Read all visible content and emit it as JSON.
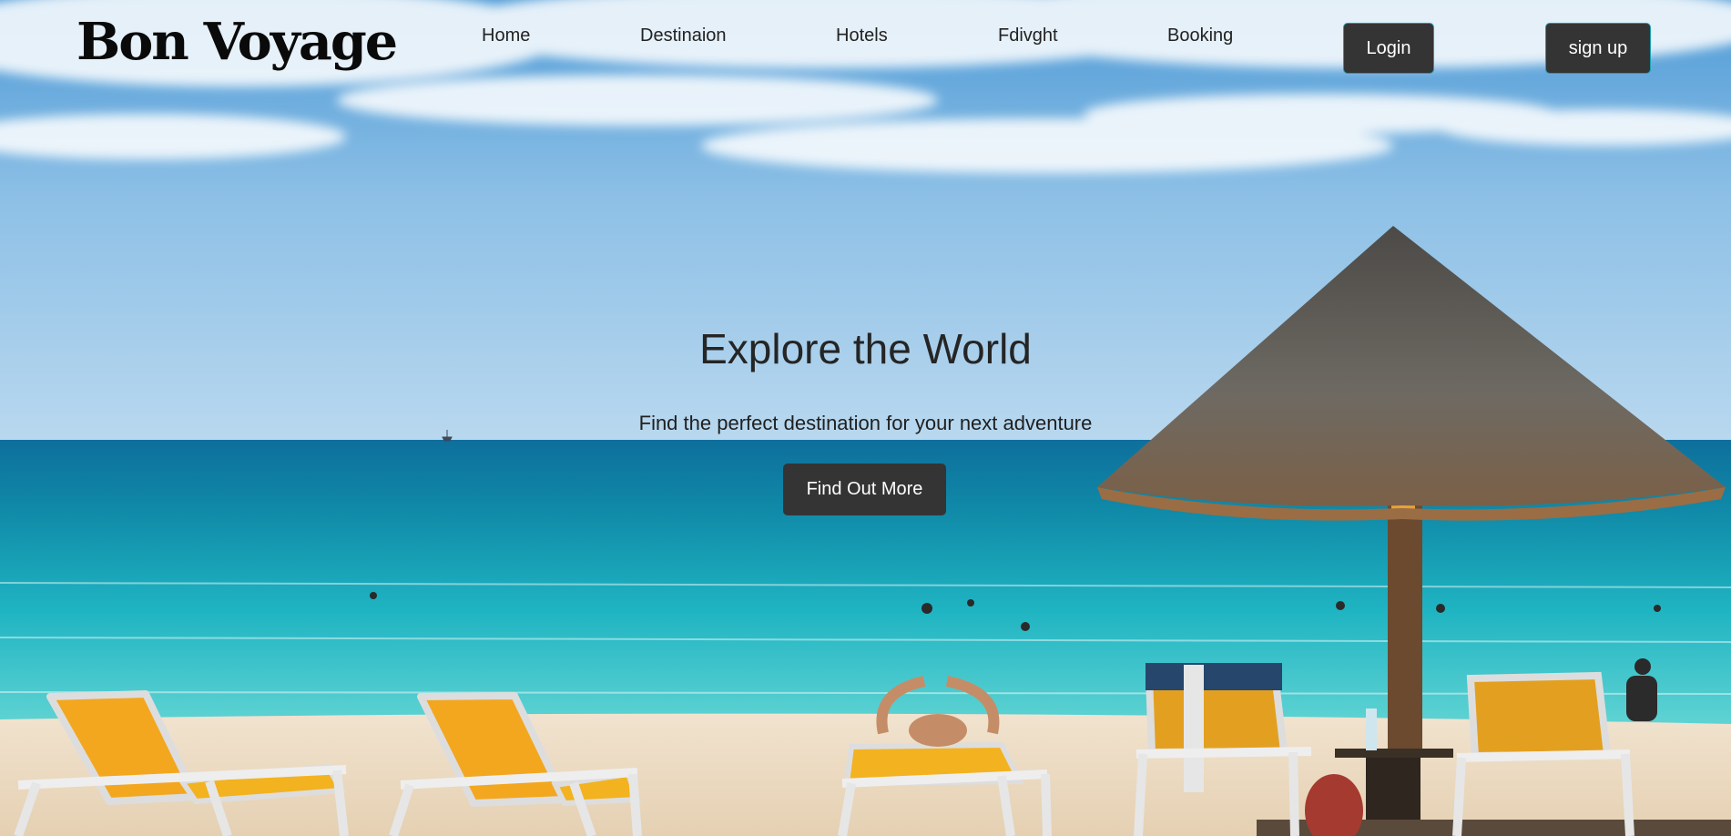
{
  "brand": {
    "logo_text": "Bon Voyage"
  },
  "nav": {
    "items": [
      {
        "label": "Home"
      },
      {
        "label": "Destinaion"
      },
      {
        "label": "Hotels"
      },
      {
        "label": "Fdivght"
      },
      {
        "label": "Booking"
      }
    ],
    "login_label": "Login",
    "signup_label": "sign up"
  },
  "hero": {
    "title": "Explore the World",
    "subtitle": "Find the perfect destination for your next adventure",
    "cta_label": "Find Out More"
  },
  "colors": {
    "button_bg": "#343434",
    "button_border": "#1a9fb0",
    "sea": "#1fb4c2",
    "sand": "#ecdcc4"
  }
}
